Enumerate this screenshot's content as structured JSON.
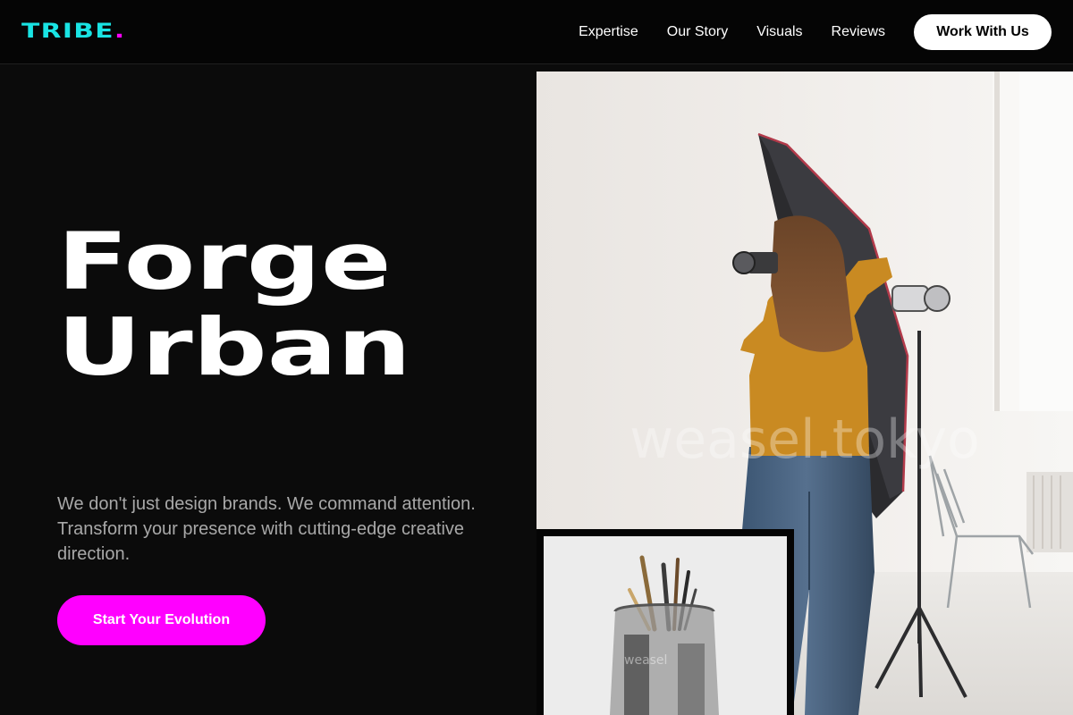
{
  "brand": {
    "name": "TRIBE",
    "dot": ".",
    "color": "#19e3e3",
    "dot_color": "#ff00ff"
  },
  "nav": {
    "links": [
      "Expertise",
      "Our Story",
      "Visuals",
      "Reviews"
    ],
    "cta": "Work With Us"
  },
  "hero": {
    "headline_line1": "Forge",
    "headline_line2": "Urban",
    "tagline": "We don't just design brands. We command attention. Transform your presence with cutting-edge creative direction.",
    "cta": "Start Your Evolution",
    "accent": "#ff00ff"
  },
  "images": {
    "main_watermark": "weasel.tokyo",
    "small_watermark": "weasel"
  }
}
